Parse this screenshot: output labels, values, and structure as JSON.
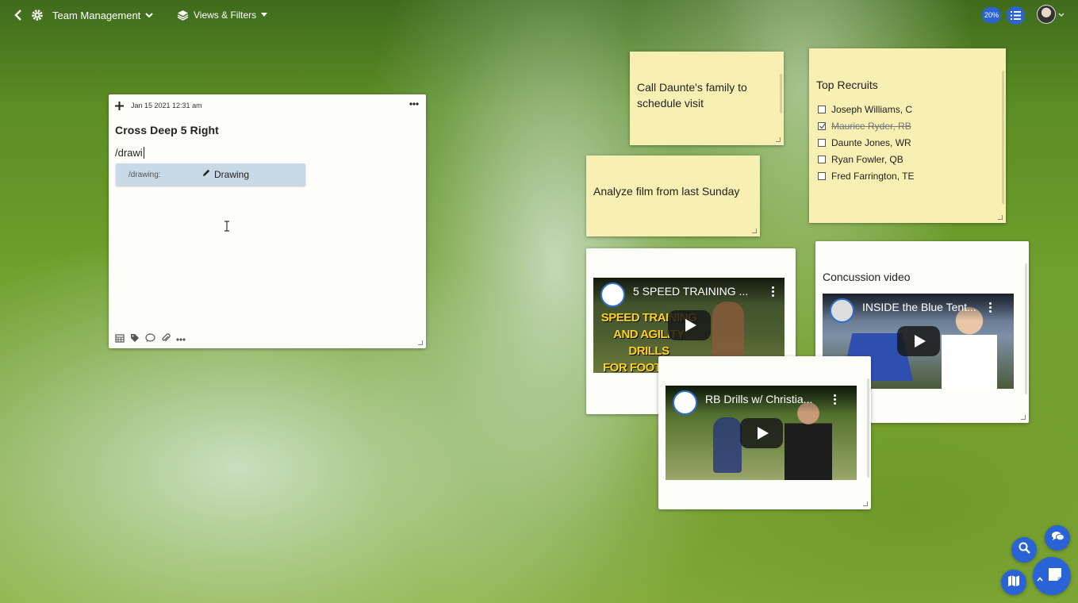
{
  "topbar": {
    "back_icon": "chevron-left-icon",
    "settings_icon": "gear-icon",
    "board_title": "Team Management",
    "views_label": "Views & Filters",
    "zoom_badge": "20%",
    "list_icon": "list-icon"
  },
  "note_editor": {
    "date": "Jan 15 2021 12:31 am",
    "title": "Cross Deep 5 Right",
    "typed_text": "/drawi",
    "suggestion": {
      "command": "/drawing:",
      "label": "Drawing"
    },
    "toolbar_icons": [
      "calendar-icon",
      "tag-icon",
      "comment-icon",
      "attachment-icon",
      "more-icon"
    ]
  },
  "sticky_call": {
    "text": "Call Daunte's family to schedule visit"
  },
  "sticky_film": {
    "text": "Analyze film from last Sunday"
  },
  "recruits": {
    "title": "Top Recruits",
    "items": [
      {
        "label": "Joseph Williams, C",
        "checked": false
      },
      {
        "label": "Maurice Ryder, RB",
        "checked": true
      },
      {
        "label": "Daunte Jones, WR",
        "checked": false
      },
      {
        "label": "Ryan Fowler, QB",
        "checked": false
      },
      {
        "label": "Fred Farrington, TE",
        "checked": false
      }
    ]
  },
  "video_speed": {
    "title": "5 SPEED TRAINING ...",
    "thumb_lines": [
      "SPEED TRAINING",
      "AND AGILITY DRILLS",
      "FOR FOOTBALL!"
    ]
  },
  "video_concussion": {
    "heading": "Concussion video",
    "title": "INSIDE the Blue Tent..."
  },
  "video_rb": {
    "title": "RB Drills w/ Christia..."
  },
  "fabs": {
    "search_icon": "search-icon",
    "chat_icon": "chat-icon",
    "map_icon": "map-icon",
    "note_icon": "note-icon"
  },
  "colors": {
    "accent": "#2a63d6",
    "sticky": "#f8efb3",
    "suggestion_bg": "#c9d9e6"
  }
}
